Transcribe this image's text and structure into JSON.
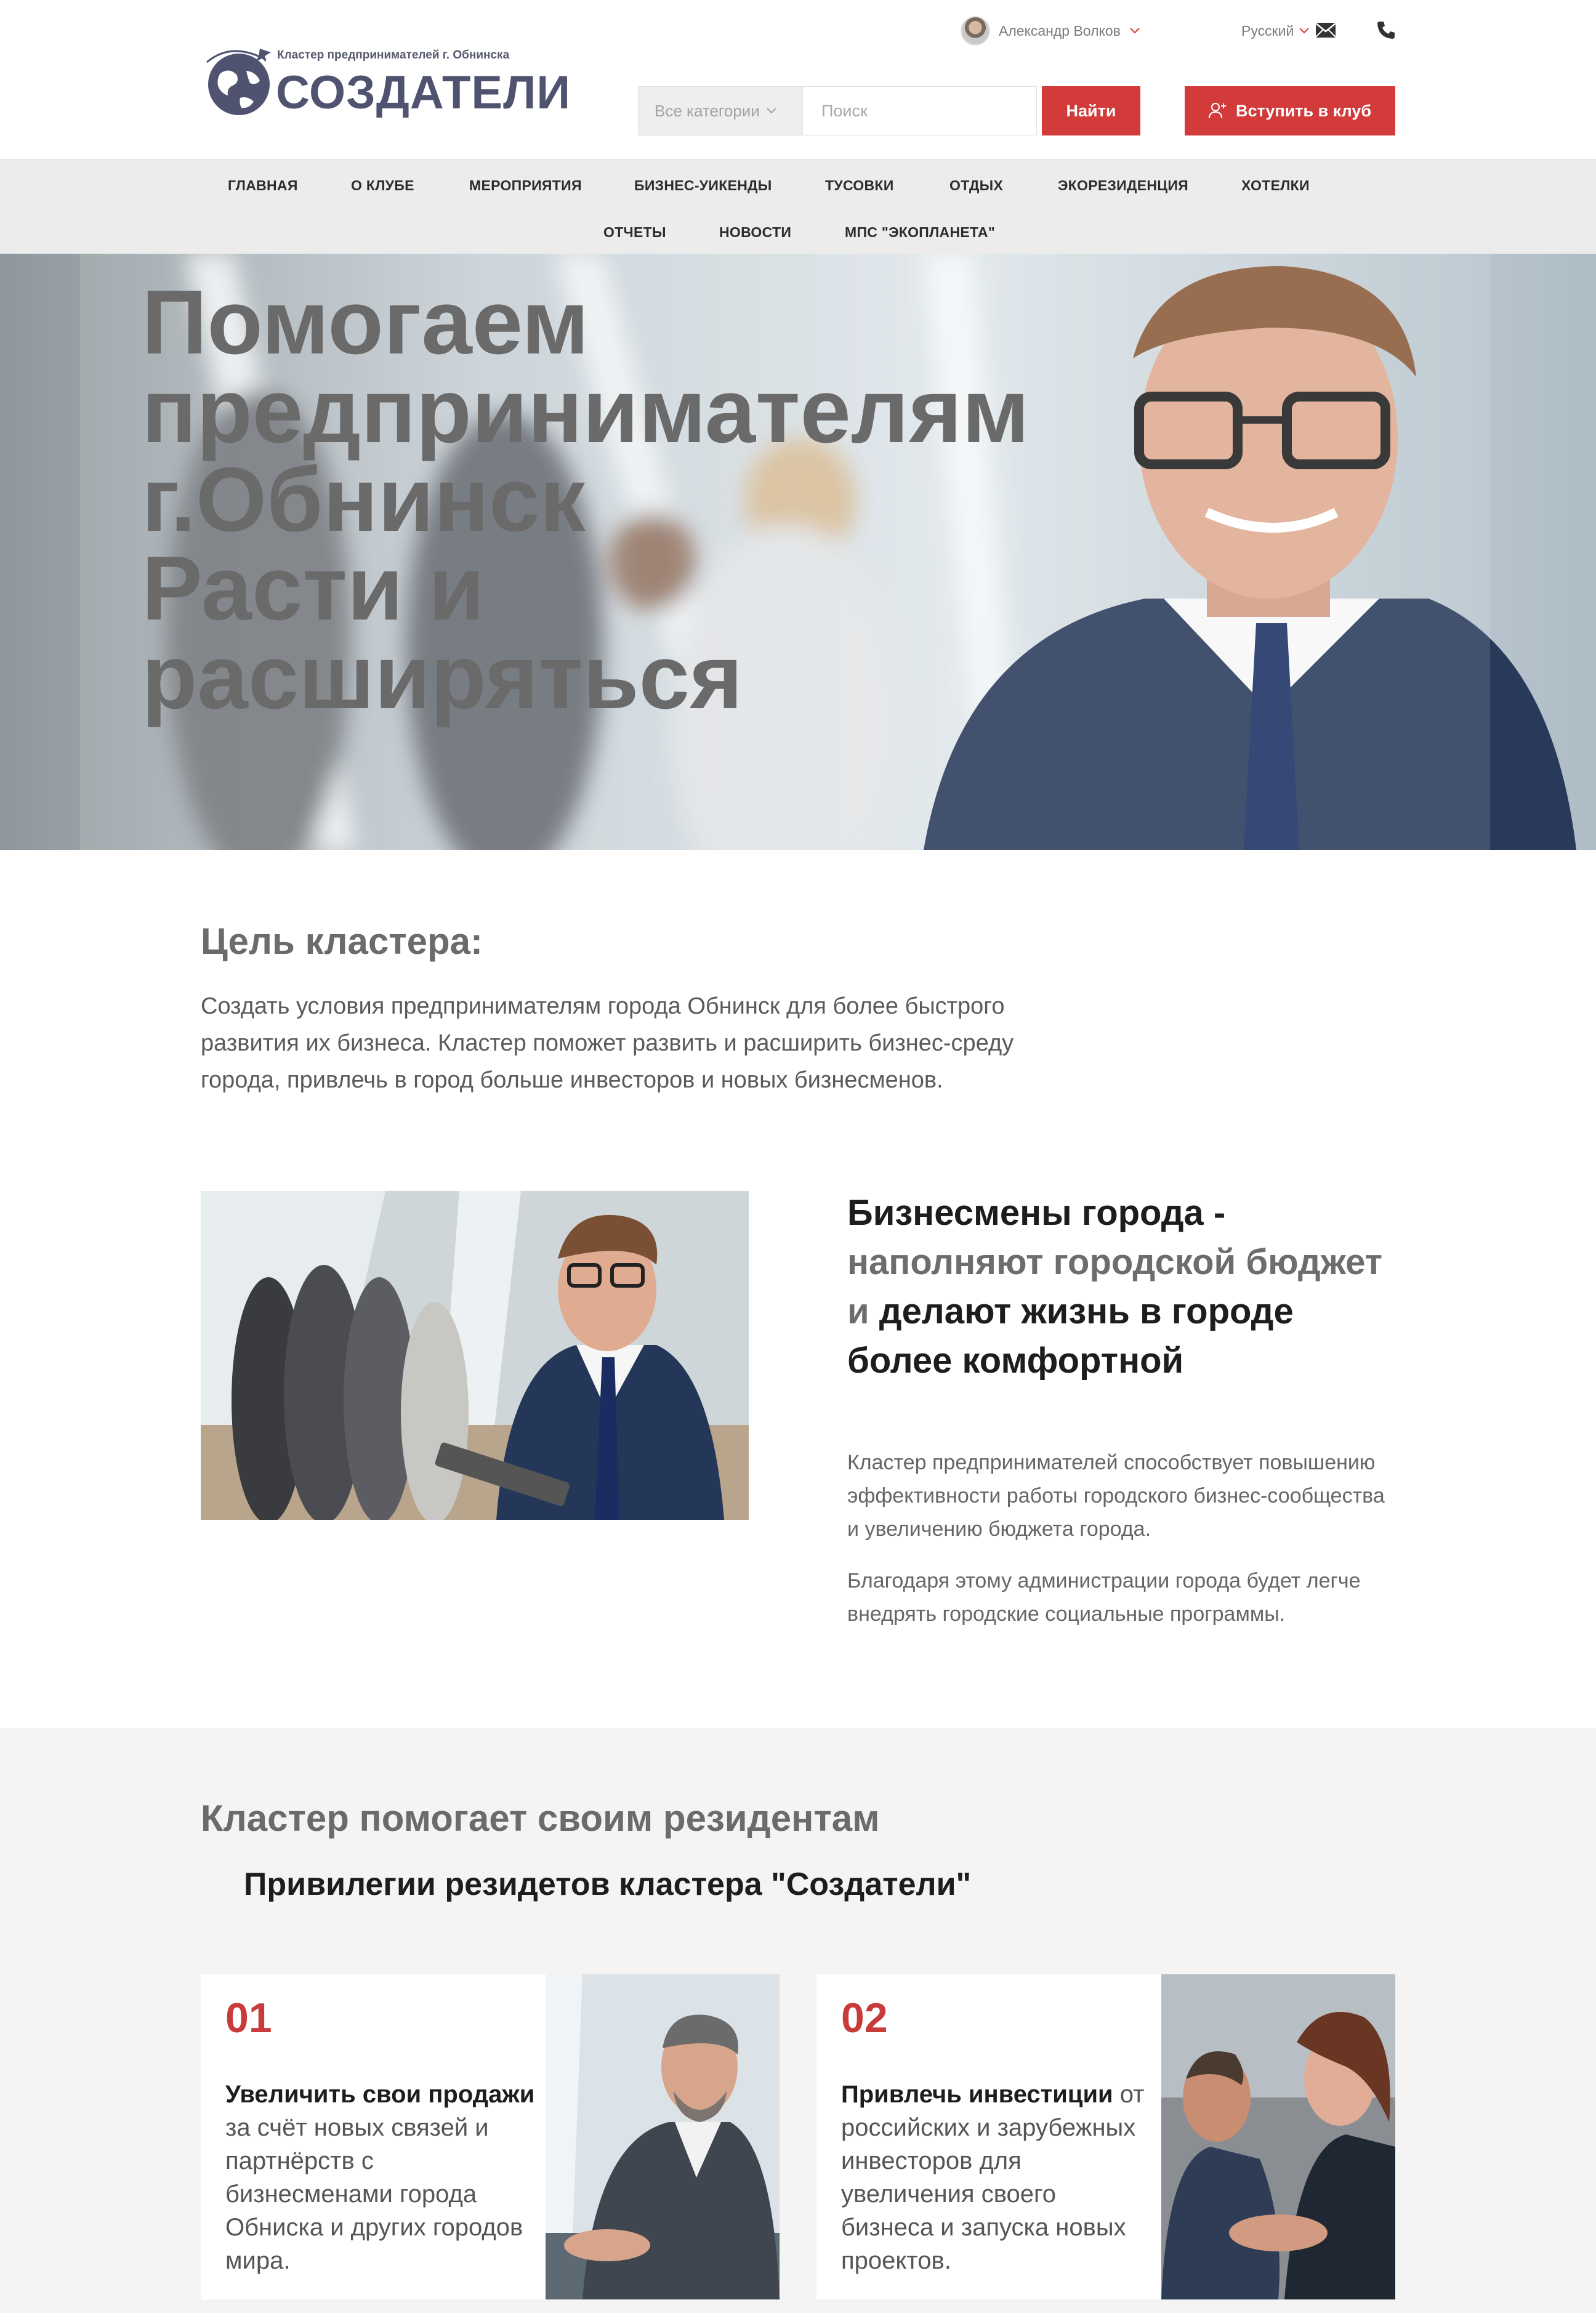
{
  "header": {
    "logo_tagline": "Кластер предпринимателей г. Обнинска",
    "logo_title": "СОЗДАТЕЛИ",
    "user_name": "Александр Волков",
    "language": "Русский",
    "search_category": "Все категории",
    "search_placeholder": "Поиск",
    "search_button": "Найти",
    "join_button": "Вступить в клуб"
  },
  "nav": {
    "row1": [
      "ГЛАВНАЯ",
      "О КЛУБЕ",
      "МЕРОПРИЯТИЯ",
      "БИЗНЕС-УИКЕНДЫ",
      "ТУСОВКИ",
      "ОТДЫХ",
      "ЭКОРЕЗИДЕНЦИЯ",
      "ХОТЕЛКИ"
    ],
    "row2": [
      "ОТЧЕТЫ",
      "НОВОСТИ",
      "МПС \"ЭКОПЛАНЕТА\""
    ]
  },
  "hero": {
    "lines": [
      "Помогаем",
      "предпринимателям",
      "г.Обнинск",
      "Расти и",
      "расширяться"
    ]
  },
  "goal": {
    "title": "Цель кластера:",
    "text": "Создать условия предпринимателям города Обнинск для более быстрого развития их бизнеса. Кластер поможет развить и расширить бизнес-среду города, привлечь в город больше инвесторов и новых бизнесменов."
  },
  "business": {
    "head_part1": "Бизнесмены города -",
    "head_part2": "наполняют городской бюджет и",
    "head_part3": "делают жизнь в городе более комфортной",
    "p1": "Кластер предпринимателей способствует повышению эффективности работы городского бизнес-сообщества и увеличению бюджета города.",
    "p2": "Благодаря этому администрации города будет легче внедрять городские социальные программы."
  },
  "privileges": {
    "title": "Кластер помогает своим резидентам",
    "subtitle": "Привилегии резидетов кластера \"Создатели\"",
    "cards": [
      {
        "number": "01",
        "bold": "Увеличить свои продажи",
        "text": " за счёт новых связей и партнёрств с бизнесменами города Обниска и других городов мира."
      },
      {
        "number": "02",
        "bold": "Привлечь инвестиции",
        "text": " от российских и зарубежных инвесторов для увеличения своего бизнеса и запуска новых проектов."
      }
    ]
  },
  "colors": {
    "accent": "#d33a3a",
    "nav_bg": "#ececec",
    "section_bg": "#f4f4f4",
    "logo": "#4f5370"
  },
  "icons": {
    "logo": "globe-plane-icon",
    "mail": "mail-icon",
    "phone": "phone-icon",
    "chevron": "chevron-down-icon",
    "user_add": "user-plus-icon"
  }
}
